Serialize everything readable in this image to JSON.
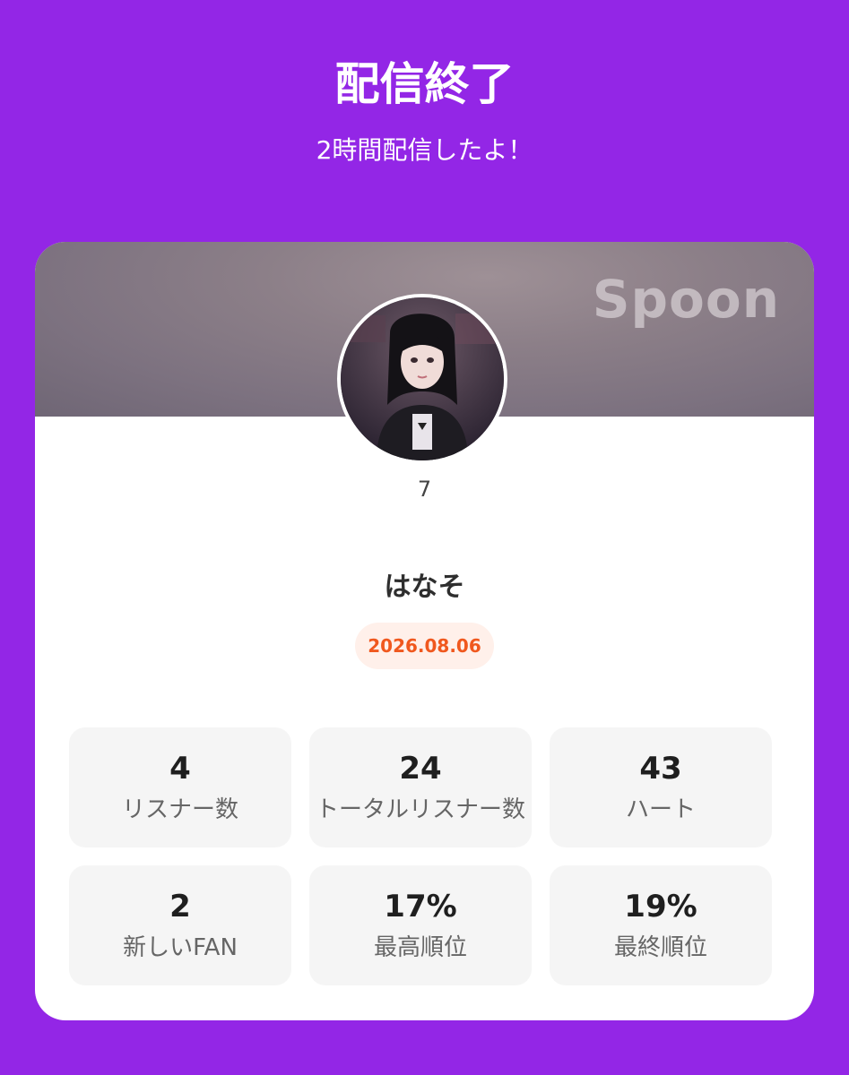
{
  "header": {
    "title": "配信終了",
    "subtitle": "2時間配信したよ！"
  },
  "card": {
    "brand": "Spoon",
    "level": "7",
    "name": "はなそ",
    "date": "2026.08.06"
  },
  "stats": [
    {
      "value": "4",
      "label": "リスナー数"
    },
    {
      "value": "24",
      "label": "トータルリスナー数"
    },
    {
      "value": "43",
      "label": "ハート"
    },
    {
      "value": "2",
      "label": "新しいFAN"
    },
    {
      "value": "17%",
      "label": "最高順位"
    },
    {
      "value": "19%",
      "label": "最終順位"
    }
  ],
  "colors": {
    "background": "#9326e6",
    "date_text": "#f0581e",
    "date_bg": "#fff0ea"
  }
}
